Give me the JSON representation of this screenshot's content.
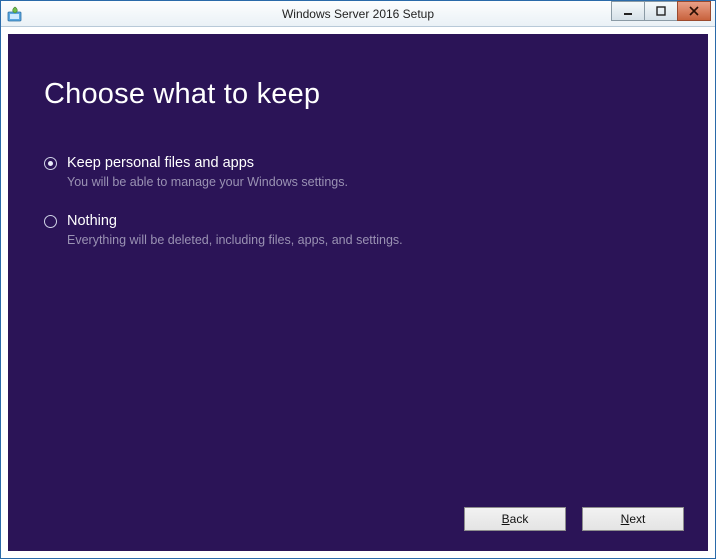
{
  "window": {
    "title": "Windows Server 2016 Setup"
  },
  "heading": "Choose what to keep",
  "options": [
    {
      "label": "Keep personal files and apps",
      "description": "You will be able to manage your Windows settings.",
      "selected": true
    },
    {
      "label": "Nothing",
      "description": "Everything will be deleted, including files, apps, and settings.",
      "selected": false
    }
  ],
  "buttons": {
    "back_prefix": "B",
    "back_rest": "ack",
    "next_prefix": "N",
    "next_rest": "ext"
  }
}
